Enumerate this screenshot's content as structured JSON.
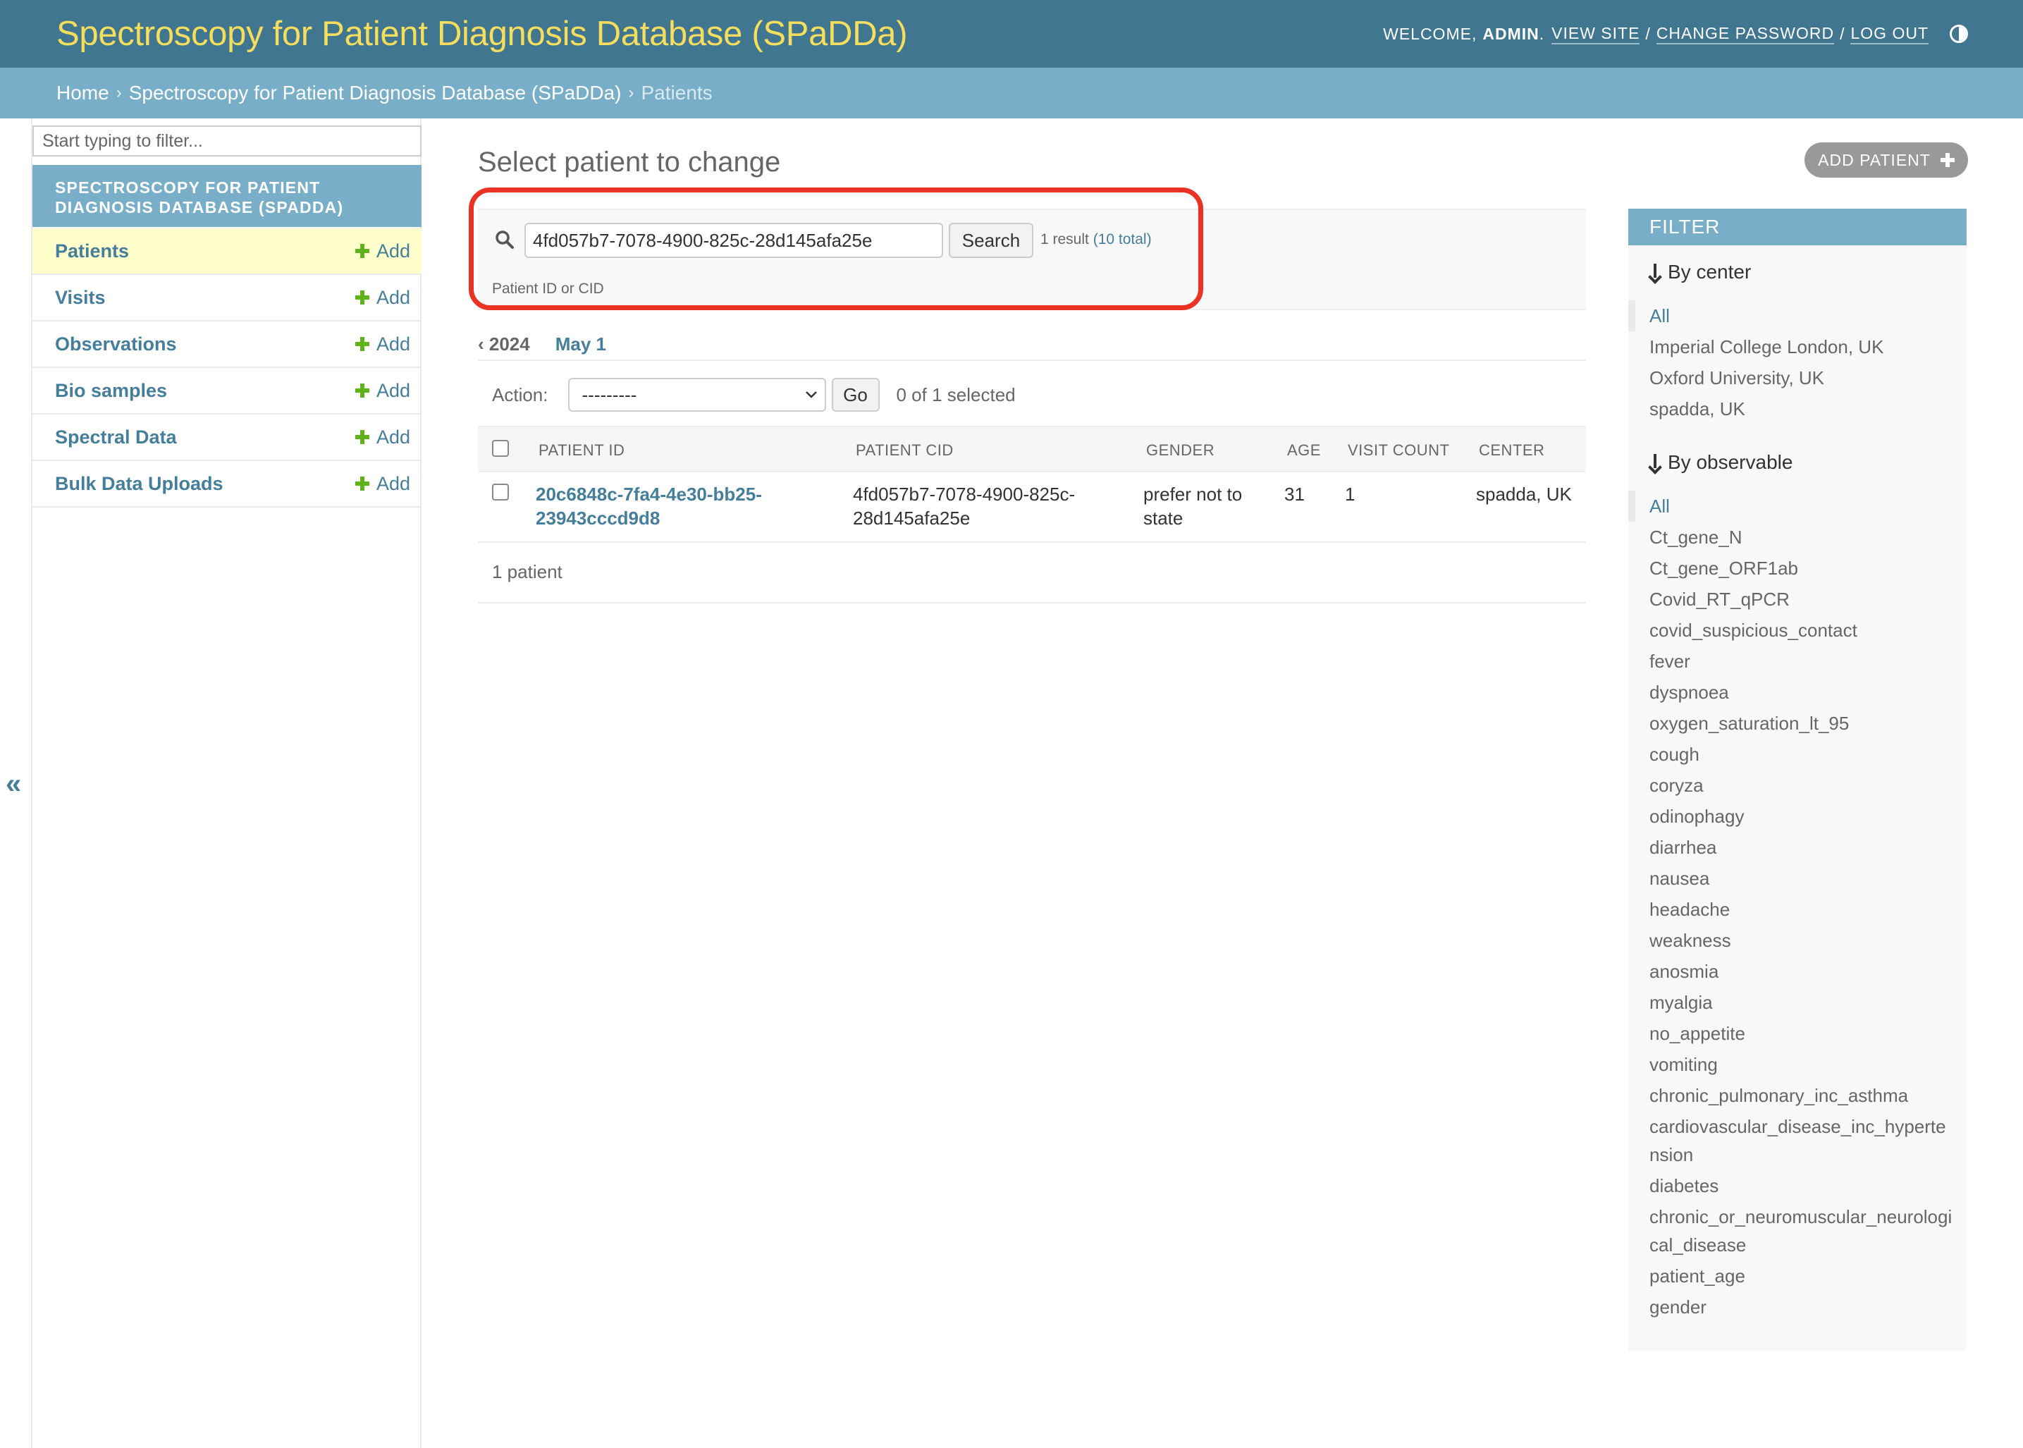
{
  "header": {
    "site_title": "Spectroscopy for Patient Diagnosis Database (SPaDDa)",
    "welcome": "WELCOME,",
    "username": "ADMIN",
    "view_site": "VIEW SITE",
    "change_password": "CHANGE PASSWORD",
    "log_out": "LOG OUT",
    "separator": "/"
  },
  "breadcrumbs": {
    "home": "Home",
    "app": "Spectroscopy for Patient Diagnosis Database (SPaDDa)",
    "current": "Patients",
    "chevron": "›"
  },
  "sidebar": {
    "filter_placeholder": "Start typing to filter...",
    "app_caption": "SPECTROSCOPY FOR PATIENT DIAGNOSIS DATABASE (SPADDA)",
    "add_label": "Add",
    "items": [
      {
        "label": "Patients"
      },
      {
        "label": "Visits"
      },
      {
        "label": "Observations"
      },
      {
        "label": "Bio samples"
      },
      {
        "label": "Spectral Data"
      },
      {
        "label": "Bulk Data Uploads"
      }
    ],
    "collapse_glyph": "«"
  },
  "content": {
    "title": "Select patient to change",
    "add_button": "ADD PATIENT"
  },
  "search": {
    "value": "4fd057b7-7078-4900-825c-28d145afa25e",
    "button": "Search",
    "result_text": "1 result",
    "total_text": "(10 total)",
    "help": "Patient ID or CID"
  },
  "date_hierarchy": {
    "back": "‹ 2024",
    "current": "May 1"
  },
  "actions": {
    "label": "Action:",
    "selected": "---------",
    "go": "Go",
    "count": "0 of 1 selected"
  },
  "table": {
    "columns": [
      "PATIENT ID",
      "PATIENT CID",
      "GENDER",
      "AGE",
      "VISIT COUNT",
      "CENTER"
    ],
    "rows": [
      {
        "patient_id_1": "20c6848c-7fa4-4e30-bb25-",
        "patient_id_2": "23943cccd9d8",
        "cid_1": "4fd057b7-7078-4900-825c-",
        "cid_2": "28d145afa25e",
        "gender_1": "prefer not to",
        "gender_2": "state",
        "age": "31",
        "visit_count": "1",
        "center": "spadda, UK"
      }
    ],
    "footer": "1 patient"
  },
  "filter": {
    "title": "FILTER",
    "by_center": {
      "heading": "By center",
      "options": [
        "All",
        "Imperial College London, UK",
        "Oxford University, UK",
        "spadda, UK"
      ]
    },
    "by_observable": {
      "heading": "By observable",
      "options": [
        "All",
        "Ct_gene_N",
        "Ct_gene_ORF1ab",
        "Covid_RT_qPCR",
        "covid_suspicious_contact",
        "fever",
        "dyspnoea",
        "oxygen_saturation_lt_95",
        "cough",
        "coryza",
        "odinophagy",
        "diarrhea",
        "nausea",
        "headache",
        "weakness",
        "anosmia",
        "myalgia",
        "no_appetite",
        "vomiting",
        "chronic_pulmonary_inc_asthma",
        "cardiovascular_disease_inc_hypertension",
        "diabetes",
        "chronic_or_neuromuscular_neurological_disease",
        "patient_age",
        "gender"
      ]
    }
  },
  "colors": {
    "header_bg": "#417690",
    "breadcrumb_bg": "#79aec8",
    "brand_yellow": "#f5dd5d",
    "link": "#447e9b",
    "highlight": "#ea3323",
    "add_green": "#5eb31a"
  }
}
